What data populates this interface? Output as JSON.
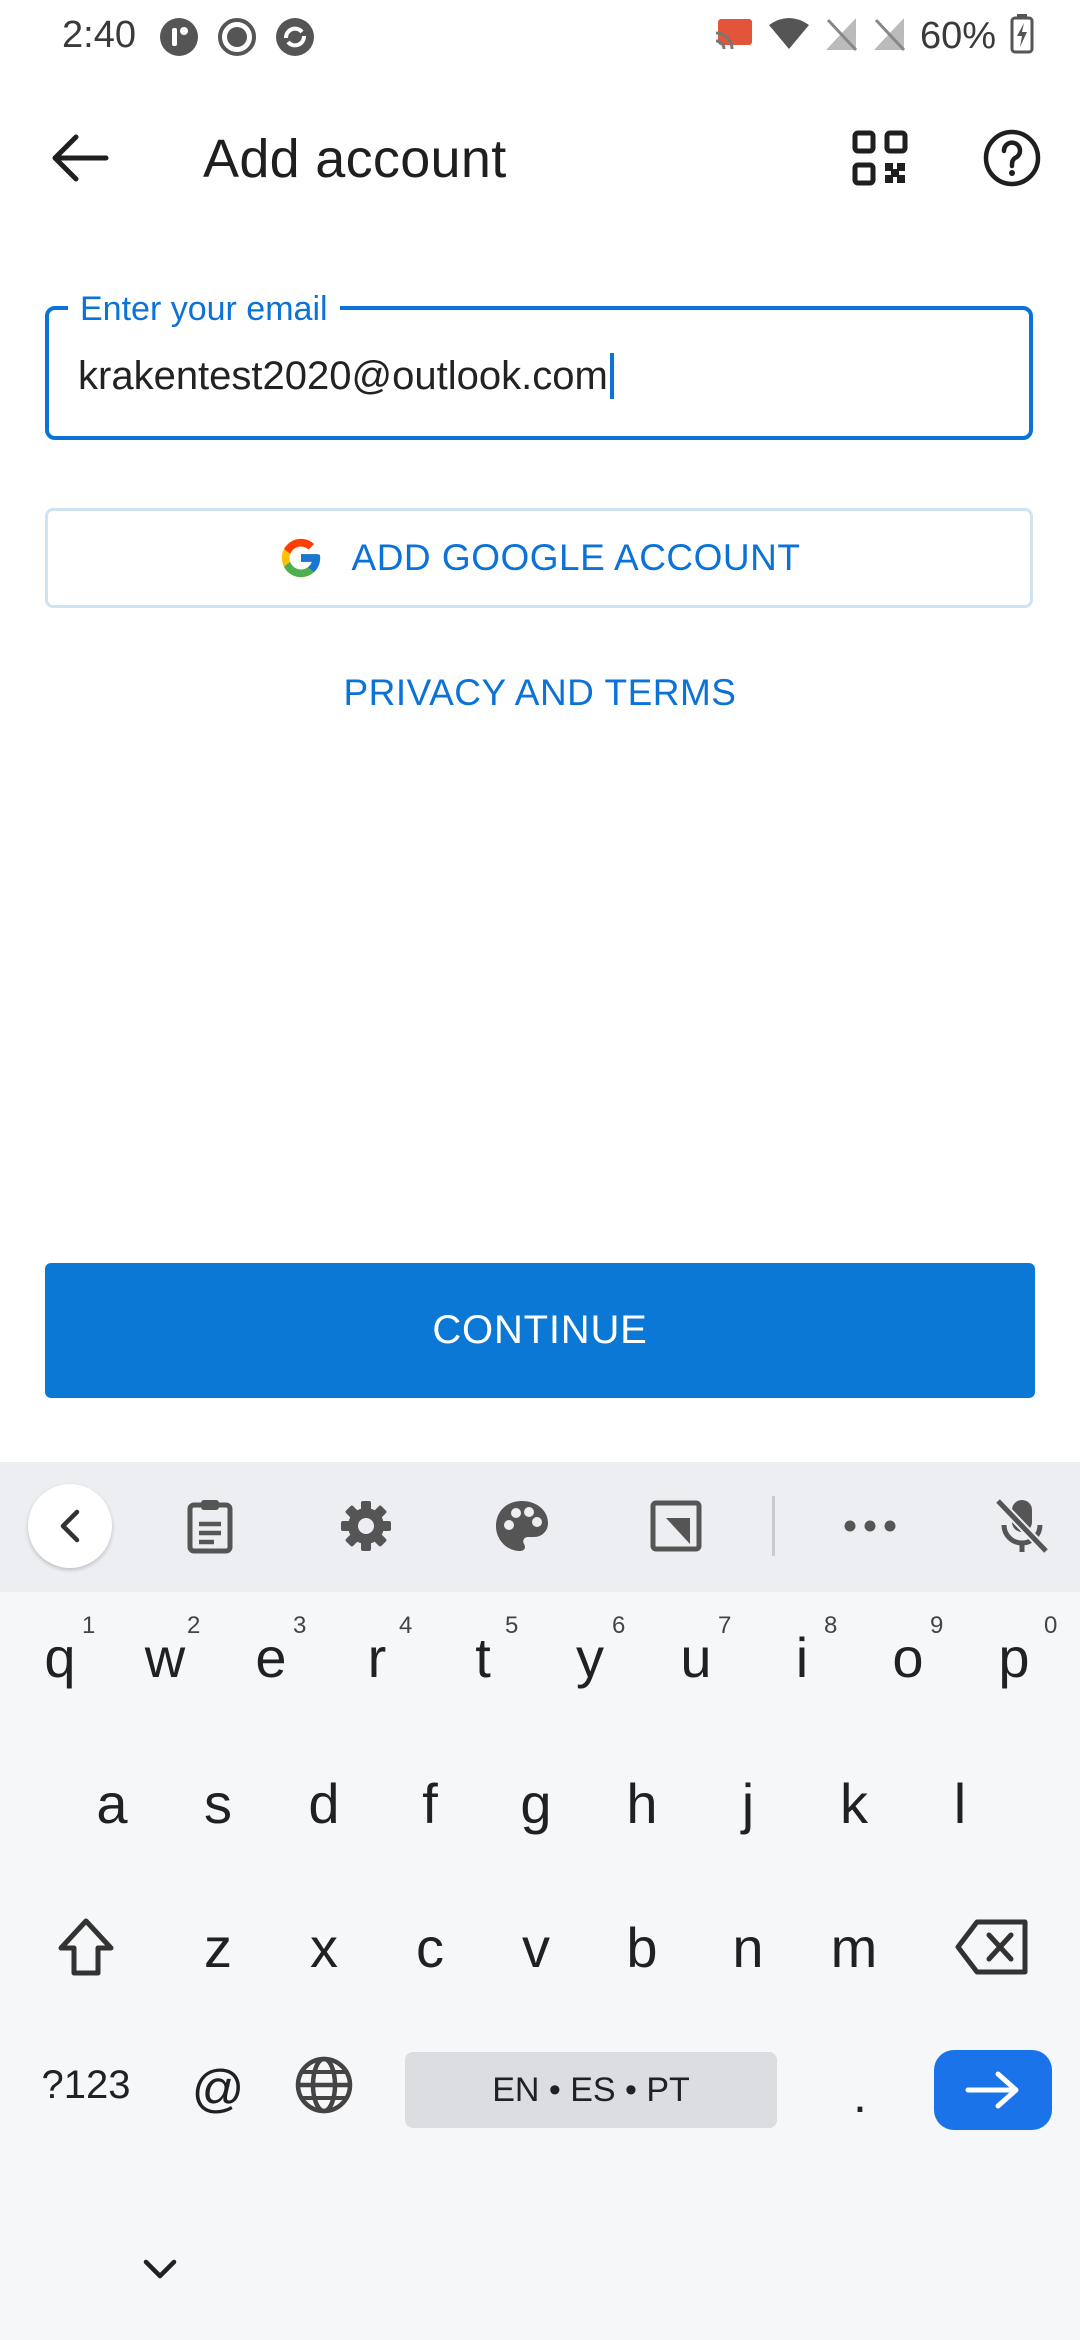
{
  "status_bar": {
    "time": "2:40",
    "battery": "60%",
    "left_icons": [
      "app-icon",
      "record-icon",
      "sync-icon"
    ],
    "right_icons": [
      "cast-icon",
      "wifi-icon",
      "no-sim-icon",
      "no-sim-icon",
      "battery-charging-icon"
    ]
  },
  "app_bar": {
    "title": "Add account",
    "back_icon": "arrow-left-icon",
    "qr_icon": "qr-code-icon",
    "help_icon": "help-circle-icon"
  },
  "email": {
    "label": "Enter your email",
    "value": "krakentest2020@outlook.com"
  },
  "google_button": {
    "label": "ADD GOOGLE ACCOUNT",
    "icon": "google-logo-icon"
  },
  "privacy_link": "PRIVACY AND TERMS",
  "continue_button": "CONTINUE",
  "colors": {
    "accent": "#0b72d8",
    "primary_button": "#0a78d4",
    "keyboard_enter": "#1a73e8"
  },
  "keyboard": {
    "toolbar_icons": [
      "chevron-left-icon",
      "clipboard-icon",
      "settings-icon",
      "palette-icon",
      "resize-icon",
      "more-icon",
      "mic-off-icon"
    ],
    "row1": [
      "q",
      "w",
      "e",
      "r",
      "t",
      "y",
      "u",
      "i",
      "o",
      "p"
    ],
    "row1_hints": [
      "1",
      "2",
      "3",
      "4",
      "5",
      "6",
      "7",
      "8",
      "9",
      "0"
    ],
    "row2": [
      "a",
      "s",
      "d",
      "f",
      "g",
      "h",
      "j",
      "k",
      "l"
    ],
    "row3": [
      "z",
      "x",
      "c",
      "v",
      "b",
      "n",
      "m"
    ],
    "symbols_key": "?123",
    "at_key": "@",
    "space_label": "EN • ES • PT",
    "period_key": "."
  }
}
